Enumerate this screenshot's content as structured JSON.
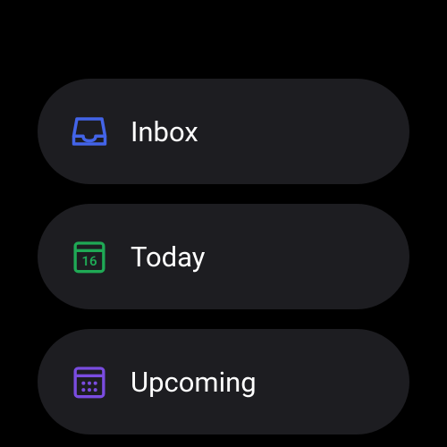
{
  "menu": {
    "items": [
      {
        "label": "Inbox",
        "icon": "inbox",
        "icon_color": "#4364e8"
      },
      {
        "label": "Today",
        "icon": "calendar-today",
        "icon_color": "#1fa955",
        "day": "16"
      },
      {
        "label": "Upcoming",
        "icon": "calendar-upcoming",
        "icon_color": "#7a4ce0"
      }
    ]
  }
}
